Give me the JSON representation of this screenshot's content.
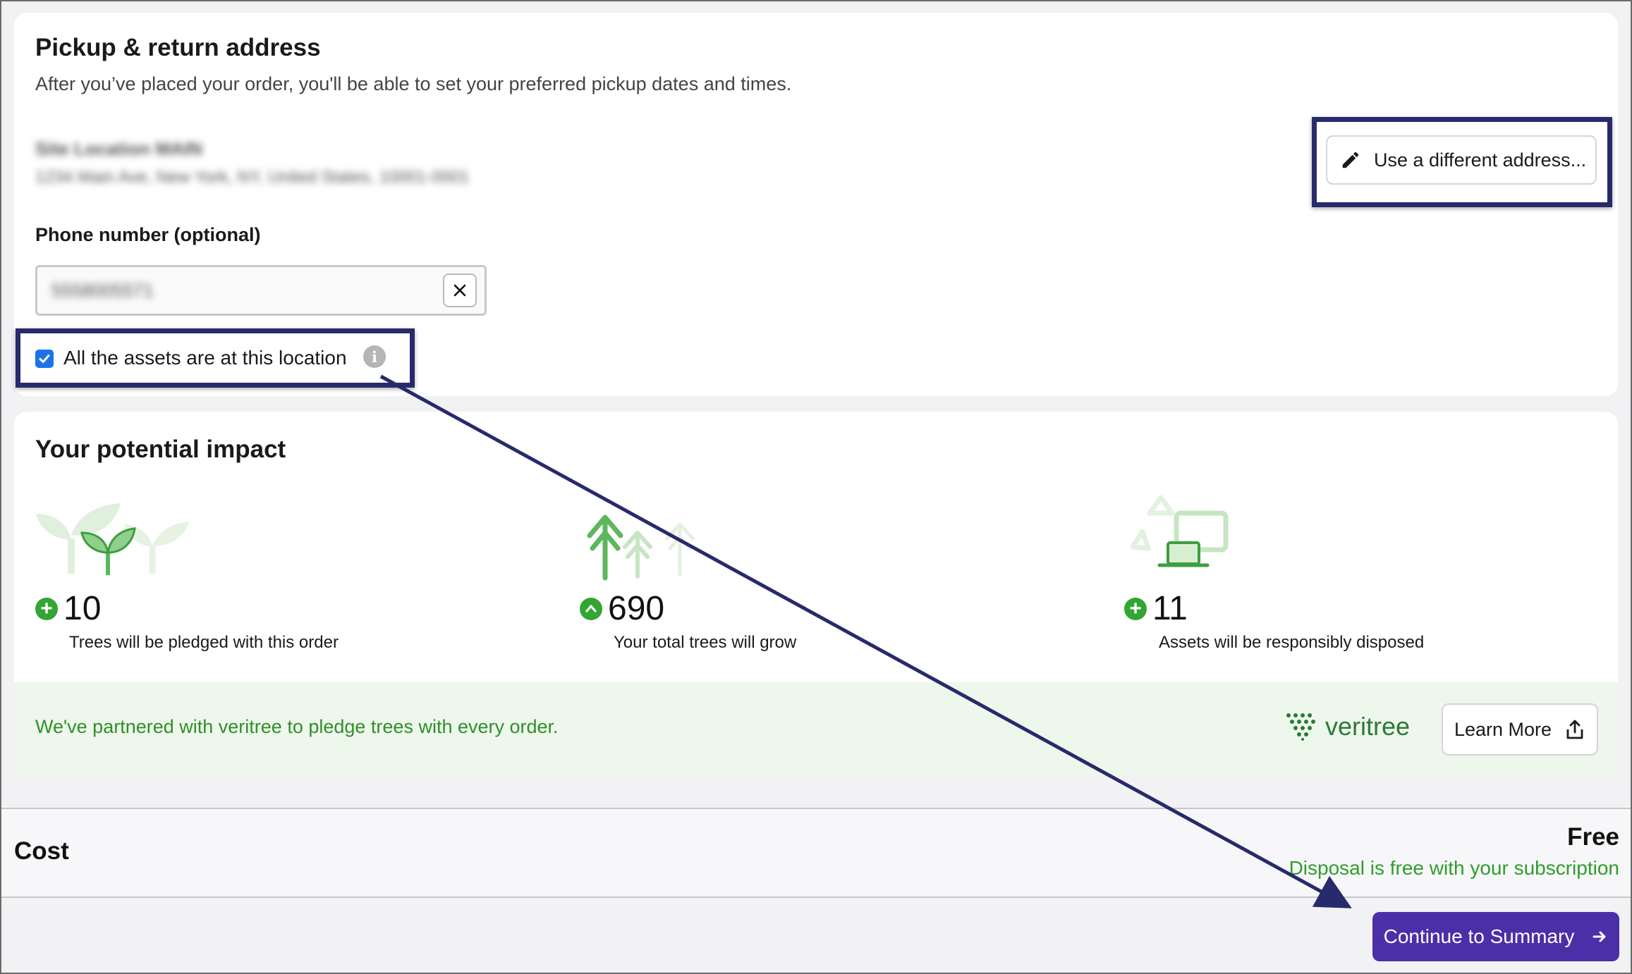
{
  "address_section": {
    "title": "Pickup & return address",
    "subtitle": "After you’ve placed your order, you'll be able to set your preferred pickup dates and times.",
    "address_name": "Site Location MAIN",
    "address_line": "1234 Main Ave, New York, NY, United States, 10001-0001",
    "different_address_label": "Use a different address...",
    "phone_label": "Phone number (optional)",
    "phone_value": "5558005571",
    "assets_checkbox_label": "All the assets are at this location",
    "assets_checkbox_checked": true
  },
  "impact_section": {
    "title": "Your potential impact",
    "metrics": [
      {
        "value": "10",
        "caption": "Trees will be pledged with this order",
        "icon": "plus-circle-icon"
      },
      {
        "value": "690",
        "caption": "Your total trees will grow",
        "icon": "arrow-up-circle-icon"
      },
      {
        "value": "11",
        "caption": "Assets will be responsibly disposed",
        "icon": "plus-circle-icon"
      }
    ],
    "partner_text": "We've partnered with veritree to pledge trees with every order.",
    "partner_brand": "veritree",
    "learn_more_label": "Learn More"
  },
  "cost": {
    "label": "Cost",
    "value": "Free",
    "note": "Disposal is free with your subscription"
  },
  "actions": {
    "continue_label": "Continue to Summary"
  },
  "colors": {
    "accent_green": "#33a532",
    "primary_button": "#4b2fa8",
    "highlight_border": "#272a6b"
  }
}
